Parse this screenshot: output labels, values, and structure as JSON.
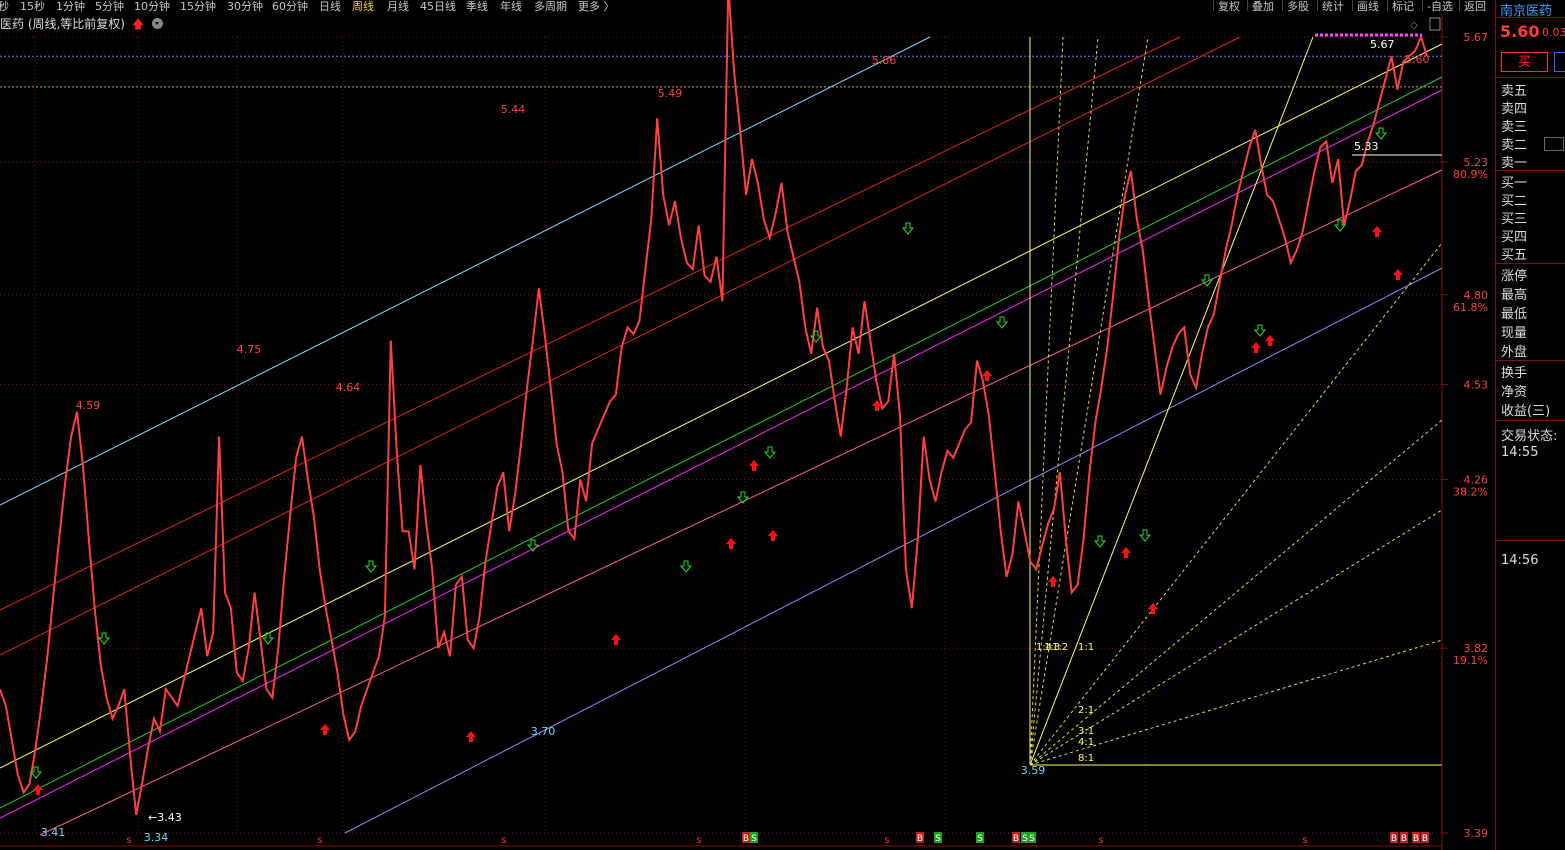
{
  "toolbar": {
    "periods": [
      "秒",
      "15秒",
      "1分钟",
      "5分钟",
      "10分钟",
      "15分钟",
      "30分钟",
      "60分钟",
      "日线",
      "周线",
      "月线",
      "45日线",
      "季线",
      "年线",
      "多周期",
      "更多 〉"
    ],
    "active_period": "周线",
    "tools": [
      "复权",
      "叠加",
      "多股",
      "统计",
      "画线",
      "标记",
      "-自选",
      "返回"
    ]
  },
  "chart_header": {
    "title": "医药 (周线,等比前复权)",
    "arrow": "🡅"
  },
  "sidebar": {
    "stock_name": "南京医药",
    "price": "5.60",
    "change": "0.03",
    "buy_label": "买",
    "sell_levels": [
      "卖五",
      "卖四",
      "卖三",
      "卖二",
      "卖一"
    ],
    "buy_levels": [
      "买一",
      "买二",
      "买三",
      "买四",
      "买五"
    ],
    "stats": [
      "涨停",
      "最高",
      "最低",
      "现量",
      "外盘"
    ],
    "extra": [
      "换手",
      "净资",
      "收益(三)"
    ],
    "trade_status_label": "交易状态:",
    "times": [
      "14:55",
      "14:56"
    ]
  },
  "colors": {
    "price_line": "#ff4040",
    "background": "#000000",
    "grid": "#7a1010",
    "channel_cyan": "#87d8ff",
    "channel_red": "#e02020",
    "channel_yellow": "#ffff60",
    "channel_green": "#20d020",
    "channel_magenta": "#ff20ff",
    "channel_pink": "#ff6080",
    "channel_violet": "#8a8aff"
  },
  "chart_data": {
    "type": "line",
    "title": "医药 (周线,等比前复权)",
    "y_scale": "log",
    "ylim": [
      3.3,
      5.75
    ],
    "y_ticks": [
      "5.67",
      "5.23",
      "4.80",
      "4.53",
      "4.26",
      "3.82",
      "3.39"
    ],
    "fib_levels": [
      "80.9%",
      "61.8%",
      "38.2%",
      "19.1%"
    ],
    "fib_values": [
      5.23,
      4.8,
      4.26,
      3.82
    ],
    "current_price": 5.6,
    "reference_level": 5.49,
    "series": [
      {
        "values": [
          3.72,
          3.68,
          3.6,
          3.52,
          3.48,
          3.5,
          3.58,
          3.68,
          3.8,
          3.95,
          4.1,
          4.25,
          4.38,
          4.45,
          4.3,
          4.1,
          3.92,
          3.78,
          3.7,
          3.65,
          3.68,
          3.72,
          3.56,
          3.43,
          3.5,
          3.58,
          3.65,
          3.62,
          3.72,
          3.7,
          3.68,
          3.74,
          3.8,
          3.86,
          3.92,
          3.8,
          3.86,
          4.38,
          3.96,
          3.92,
          3.76,
          3.74,
          3.82,
          3.96,
          3.84,
          3.72,
          3.7,
          3.82,
          4.0,
          4.16,
          4.32,
          4.38,
          4.26,
          4.16,
          4.02,
          3.92,
          3.84,
          3.76,
          3.66,
          3.6,
          3.62,
          3.68,
          3.72,
          3.76,
          3.8,
          3.9,
          4.66,
          4.34,
          4.12,
          4.12,
          4.02,
          4.3,
          4.14,
          4.02,
          3.82,
          3.86,
          3.8,
          3.98,
          4.0,
          3.84,
          3.82,
          3.9,
          4.04,
          4.14,
          4.24,
          4.28,
          4.12,
          4.22,
          4.36,
          4.52,
          4.66,
          4.82,
          4.68,
          4.52,
          4.36,
          4.28,
          4.12,
          4.1,
          4.26,
          4.2,
          4.36,
          4.4,
          4.44,
          4.48,
          4.5,
          4.64,
          4.7,
          4.68,
          4.72,
          4.88,
          5.04,
          5.38,
          5.12,
          5.02,
          5.1,
          4.98,
          4.9,
          4.88,
          5.02,
          4.86,
          4.84,
          4.92,
          4.78,
          5.86,
          5.54,
          5.34,
          5.12,
          5.24,
          5.16,
          5.04,
          4.98,
          5.06,
          5.16,
          5.0,
          4.92,
          4.84,
          4.7,
          4.62,
          4.76,
          4.64,
          4.6,
          4.48,
          4.38,
          4.52,
          4.7,
          4.62,
          4.78,
          4.66,
          4.54,
          4.46,
          4.48,
          4.62,
          4.44,
          4.02,
          3.92,
          4.1,
          4.38,
          4.26,
          4.2,
          4.28,
          4.34,
          4.32,
          4.36,
          4.4,
          4.42,
          4.6,
          4.54,
          4.44,
          4.28,
          4.12,
          4.0,
          4.06,
          4.2,
          4.12,
          4.04,
          4.02,
          4.08,
          4.14,
          4.18,
          4.28,
          4.1,
          3.96,
          3.98,
          4.1,
          4.28,
          4.42,
          4.52,
          4.64,
          4.8,
          4.98,
          5.12,
          5.2,
          5.04,
          4.94,
          4.78,
          4.64,
          4.5,
          4.58,
          4.64,
          4.68,
          4.7,
          4.56,
          4.52,
          4.62,
          4.7,
          4.74,
          4.84,
          4.94,
          5.02,
          5.12,
          5.2,
          5.28,
          5.34,
          5.22,
          5.12,
          5.1,
          5.04,
          4.98,
          4.9,
          4.94,
          5.0,
          5.1,
          5.2,
          5.28,
          5.3,
          5.16,
          5.24,
          5.02,
          5.1,
          5.2,
          5.22,
          5.3,
          5.36,
          5.44,
          5.52,
          5.6,
          5.48,
          5.58,
          5.6,
          5.62,
          5.67,
          5.6
        ]
      }
    ],
    "annotations": [
      "5.86",
      "5.49",
      "5.44",
      "4.75",
      "4.64",
      "4.59",
      "3.70",
      "3.41",
      "3.34",
      "←3.43",
      "3.59",
      "5.67",
      "5.33",
      "5.60"
    ],
    "gann_labels": [
      "1:4",
      "1:3",
      "1:2",
      "1:1",
      "2:1",
      "3:1",
      "4:1",
      "8:1"
    ],
    "signals": [
      "B",
      "S",
      "B",
      "S",
      "S",
      "B",
      "S",
      "S",
      "B",
      "B",
      "B",
      "B"
    ],
    "grid": true
  }
}
